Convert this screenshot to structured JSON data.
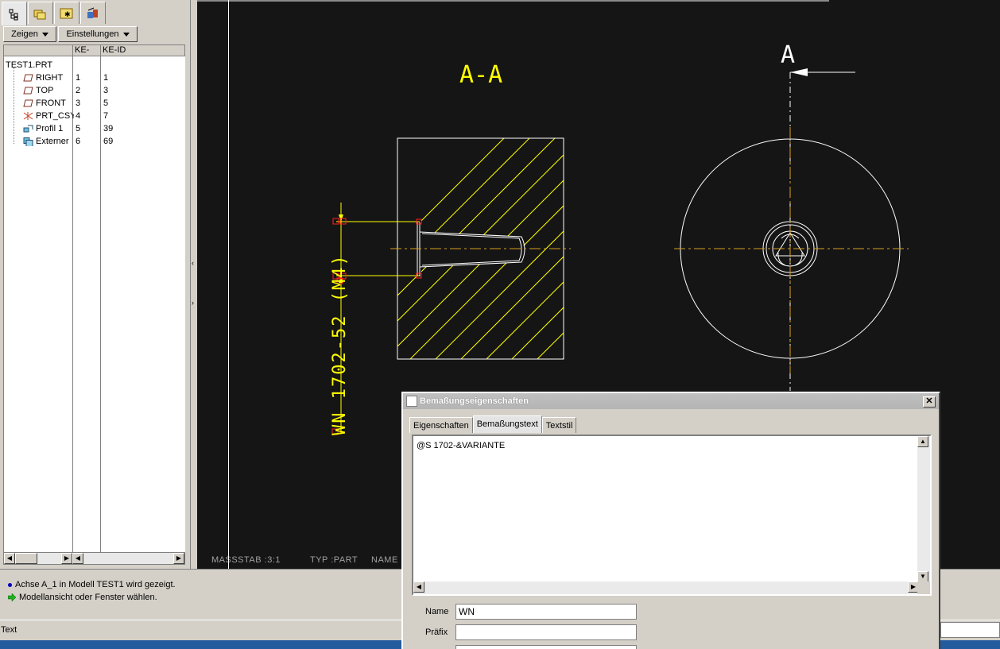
{
  "left_panel": {
    "menu": {
      "show": "Zeigen",
      "settings": "Einstellungen"
    },
    "columns": {
      "nr": "KE-Nr.",
      "id": "KE-ID"
    },
    "root": "TEST1.PRT",
    "items": [
      {
        "name": "RIGHT",
        "nr": "1",
        "id": "1",
        "icon": "datum-plane-icon"
      },
      {
        "name": "TOP",
        "nr": "2",
        "id": "3",
        "icon": "datum-plane-icon"
      },
      {
        "name": "FRONT",
        "nr": "3",
        "id": "5",
        "icon": "datum-plane-icon"
      },
      {
        "name": "PRT_CSYS",
        "nr": "4",
        "id": "7",
        "icon": "csys-icon"
      },
      {
        "name": "Profil 1",
        "nr": "5",
        "id": "39",
        "icon": "profile-icon"
      },
      {
        "name": "Externer",
        "nr": "6",
        "id": "69",
        "icon": "external-icon"
      }
    ]
  },
  "drawing": {
    "section_label": "A-A",
    "cut_label": "A",
    "dimension_text": "WN 1702-52 (M4)",
    "status": {
      "scale": "MASSSTAB :3:1",
      "type": "TYP :PART",
      "name": "NAME"
    },
    "colors": {
      "background": "#151515",
      "geometry": "#ffffff",
      "annotation": "#ffff00",
      "centerline": "#d8a020",
      "selection": "#ff2020"
    }
  },
  "messages": [
    {
      "icon": "info-dot-icon",
      "text": "Achse A_1 in Modell TEST1 wird gezeigt."
    },
    {
      "icon": "green-arrow-icon",
      "text": "Modellansicht oder Fenster wählen."
    }
  ],
  "command_bar": {
    "label": "Text"
  },
  "dialog": {
    "title": "Bemaßungseigenschaften",
    "tabs": [
      "Eigenschaften",
      "Bemaßungstext",
      "Textstil"
    ],
    "active_tab": "Bemaßungstext",
    "text_value": "@S 1702-&VARIANTE",
    "fields": [
      {
        "label": "Name",
        "value": "WN"
      },
      {
        "label": "Präfix",
        "value": ""
      }
    ]
  }
}
